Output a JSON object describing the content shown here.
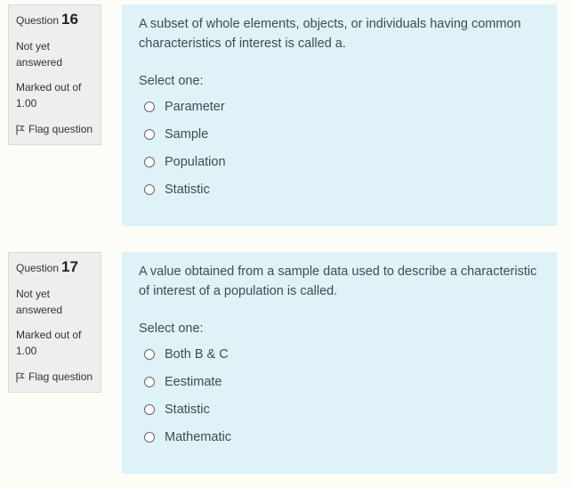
{
  "questions": [
    {
      "label": "Question",
      "number": "16",
      "state": "Not yet answered",
      "grade": "Marked out of 1.00",
      "flag_label": "Flag question",
      "text": "A subset of whole elements, objects, or individuals having common characteristics of interest is called a.",
      "prompt": "Select one:",
      "options": [
        "Parameter",
        "Sample",
        "Population",
        "Statistic"
      ]
    },
    {
      "label": "Question",
      "number": "17",
      "state": "Not yet answered",
      "grade": "Marked out of 1.00",
      "flag_label": "Flag question",
      "text": "A value obtained from a sample data used to describe a characteristic of interest of a population is called.",
      "prompt": "Select one:",
      "options": [
        "Both B & C",
        "Eestimate",
        "Statistic",
        "Mathematic"
      ]
    }
  ]
}
